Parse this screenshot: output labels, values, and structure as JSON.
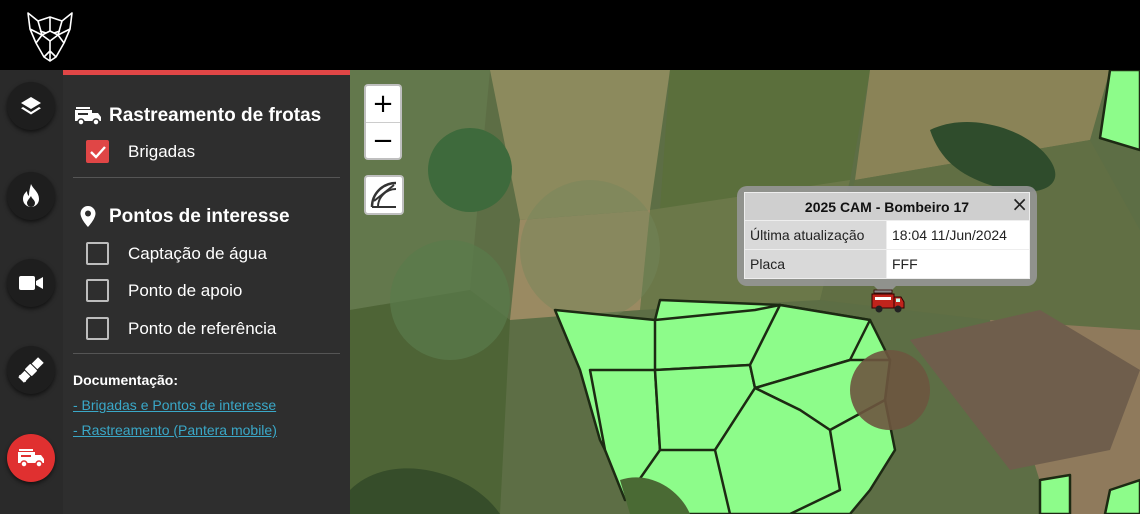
{
  "sidebar": {
    "buttons": [
      {
        "icon": "layers-icon"
      },
      {
        "icon": "fire-icon"
      },
      {
        "icon": "video-camera-icon"
      },
      {
        "icon": "satellite-icon"
      },
      {
        "icon": "fire-truck-icon",
        "active": true
      }
    ]
  },
  "panel": {
    "fleet": {
      "title": "Rastreamento de frotas",
      "icon": "fire-truck-icon",
      "items": [
        {
          "label": "Brigadas",
          "checked": true
        }
      ]
    },
    "poi": {
      "title": "Pontos de interesse",
      "icon": "map-pin-icon",
      "items": [
        {
          "label": "Captação de água",
          "checked": false
        },
        {
          "label": "Ponto de apoio",
          "checked": false
        },
        {
          "label": "Ponto de referência",
          "checked": false
        }
      ]
    },
    "docs": {
      "title": "Documentação:",
      "links": [
        "- Brigadas e Pontos de interesse",
        "- Rastreamento (Pantera mobile)"
      ]
    }
  },
  "map": {
    "zoom_in": "+",
    "zoom_out": "−",
    "measure_icon": "ruler-protractor-icon",
    "popup": {
      "title": "2025 CAM - Bombeiro 17",
      "close": "×",
      "rows": [
        {
          "label": "Última atualização",
          "value": "18:04 11/Jun/2024"
        },
        {
          "label": "Placa",
          "value": "FFF"
        }
      ]
    },
    "marker_icon": "fire-truck-icon"
  },
  "colors": {
    "accent": "#e04646",
    "link": "#3aa8c8",
    "field_highlight": "#8dfc8a"
  }
}
